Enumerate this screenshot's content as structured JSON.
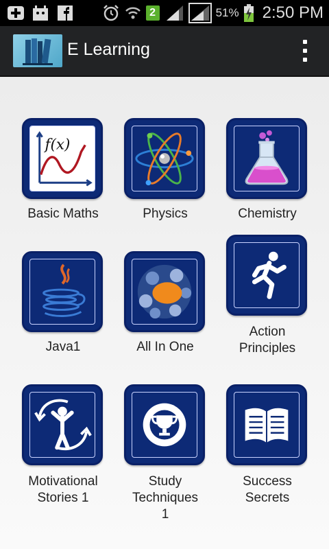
{
  "status_bar": {
    "battery_percent": "51%",
    "time": "2:50 PM",
    "notification_count": "2",
    "icons": [
      "add-icon",
      "android-notification-icon",
      "facebook-icon",
      "alarm-icon",
      "wifi-icon",
      "signal-icon",
      "battery-charging-icon"
    ]
  },
  "action_bar": {
    "title": "E Learning",
    "logo_icon": "books-icon",
    "menu_icon": "overflow-menu-icon"
  },
  "grid": {
    "items": [
      {
        "label": "Basic Maths",
        "icon": "function-graph-icon"
      },
      {
        "label": "Physics",
        "icon": "atom-icon"
      },
      {
        "label": "Chemistry",
        "icon": "flask-icon"
      },
      {
        "label": "Java1",
        "icon": "java-cup-icon"
      },
      {
        "label": "All In One",
        "icon": "cluster-icon"
      },
      {
        "label": "Action\nPrinciples",
        "icon": "running-person-icon"
      },
      {
        "label": "Motivational\nStories 1",
        "icon": "motivation-person-icon"
      },
      {
        "label": "Study\nTechniques\n1",
        "icon": "trophy-icon"
      },
      {
        "label": "Success\nSecrets",
        "icon": "book-icon"
      }
    ]
  },
  "colors": {
    "tile_background": "#0d2a76",
    "action_bar": "#222325",
    "status_bar": "#000000"
  }
}
